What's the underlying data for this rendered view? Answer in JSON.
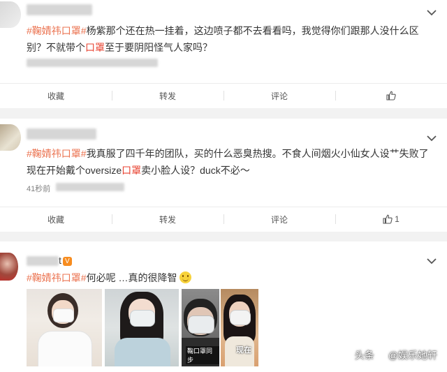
{
  "actions": {
    "save": "收藏",
    "repost": "转发",
    "comment": "评论"
  },
  "posts": [
    {
      "tag": "#鞠婧祎口罩",
      "text_a": "杨紫那个还在热一挂着，这边喷子都不去看看吗，我觉得你们跟那人没什么区别？不就带个",
      "mask_word": "口罩",
      "text_b": "至于要阴阳怪气人家吗？",
      "like_count": ""
    },
    {
      "tag": "#鞠婧祎口罩",
      "text_a": "我真服了四千年的团队，买的什么恶臭热搜。不食人间烟火小仙女人设艹失败了现在开始戴个oversize",
      "mask_word": "口罩",
      "text_b": "卖小脸人设？duck不必～",
      "time": "41秒前",
      "like_count": "1"
    },
    {
      "name_suffix": "t",
      "verified_mark": "V",
      "tag": "#鞠婧祎口罩",
      "text_a": "何必呢 …真的很降智",
      "photo_caption_1": "鞠口罩同步",
      "photo_caption_2": "现在"
    }
  ],
  "watermark": {
    "prefix": "头条",
    "handle": "@娱乐她轩"
  },
  "colors": {
    "tag": "#eb7350",
    "keyword": "#e8412f",
    "verified": "#f78c1f"
  },
  "icons": [
    "chevron-down-icon",
    "thumbs-up-icon",
    "smile-emoji-icon",
    "toutiao-logo-icon"
  ]
}
